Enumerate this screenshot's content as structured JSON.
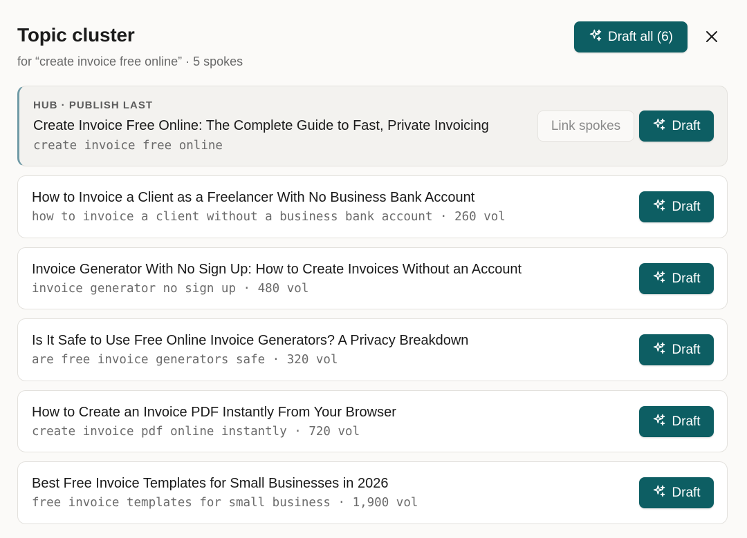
{
  "header": {
    "title": "Topic cluster",
    "subtitle": "for “create invoice free online” · 5 spokes",
    "draft_all_label": "Draft all (6)"
  },
  "hub": {
    "eyebrow": "HUB · PUBLISH LAST",
    "title": "Create Invoice Free Online: The Complete Guide to Fast, Private Invoicing",
    "keyword": "create invoice free online",
    "link_label": "Link spokes",
    "draft_label": "Draft"
  },
  "spokes": [
    {
      "title": "How to Invoice a Client as a Freelancer With No Business Bank Account",
      "keyword": "how to invoice a client without a business bank account · 260 vol",
      "draft_label": "Draft"
    },
    {
      "title": "Invoice Generator With No Sign Up: How to Create Invoices Without an Account",
      "keyword": "invoice generator no sign up · 480 vol",
      "draft_label": "Draft"
    },
    {
      "title": "Is It Safe to Use Free Online Invoice Generators? A Privacy Breakdown",
      "keyword": "are free invoice generators safe · 320 vol",
      "draft_label": "Draft"
    },
    {
      "title": "How to Create an Invoice PDF Instantly From Your Browser",
      "keyword": "create invoice pdf online instantly · 720 vol",
      "draft_label": "Draft"
    },
    {
      "title": "Best Free Invoice Templates for Small Businesses in 2026",
      "keyword": "free invoice templates for small business · 1,900 vol",
      "draft_label": "Draft"
    }
  ],
  "colors": {
    "accent": "#0d5e63",
    "hub_bar": "#6f9aa6"
  },
  "icons": {
    "draft": "sparkles-icon",
    "close": "close-icon"
  }
}
